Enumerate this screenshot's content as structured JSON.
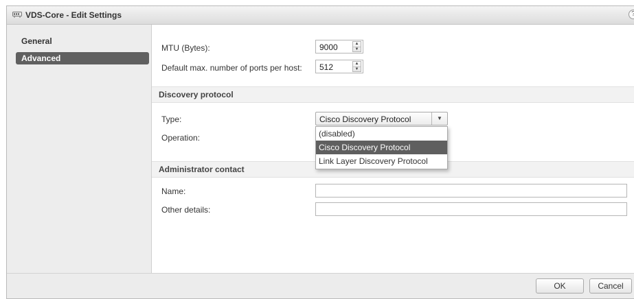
{
  "window": {
    "title": "VDS-Core - Edit Settings",
    "help_glyph": "?"
  },
  "sidebar": {
    "items": [
      {
        "label": "General"
      },
      {
        "label": "Advanced"
      }
    ]
  },
  "advanced": {
    "mtu": {
      "label": "MTU (Bytes):",
      "value": "9000"
    },
    "ports": {
      "label": "Default max. number of ports per host:",
      "value": "512"
    }
  },
  "discovery": {
    "heading": "Discovery protocol",
    "type_label": "Type:",
    "type_value": "Cisco Discovery Protocol",
    "operation_label": "Operation:",
    "options": [
      "(disabled)",
      "Cisco Discovery Protocol",
      "Link Layer Discovery Protocol"
    ],
    "selected_index": 1
  },
  "admin": {
    "heading": "Administrator contact",
    "name_label": "Name:",
    "name_value": "",
    "details_label": "Other details:",
    "details_value": ""
  },
  "footer": {
    "ok": "OK",
    "cancel": "Cancel"
  },
  "colors": {
    "selected_bg": "#606060",
    "sidebar_bg": "#ededed",
    "section_bg": "#f2f2f2"
  }
}
